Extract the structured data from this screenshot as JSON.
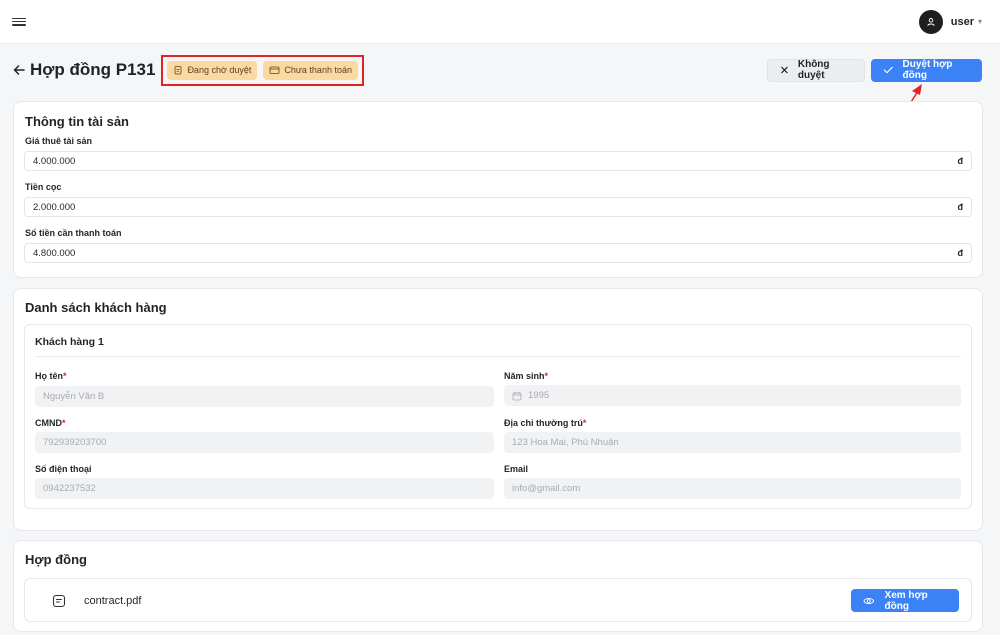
{
  "topbar": {
    "username": "user"
  },
  "header": {
    "title": "Hợp đồng P131",
    "badges": [
      "Đang chờ duyệt",
      "Chưa thanh toán"
    ],
    "reject_label": "Không duyệt",
    "approve_label": "Duyệt hợp đồng"
  },
  "property": {
    "title": "Thông tin tài sản",
    "fields": [
      {
        "label": "Giá thuê tài sản",
        "value": "4.000.000",
        "unit": "đ"
      },
      {
        "label": "Tiền cọc",
        "value": "2.000.000",
        "unit": "đ"
      },
      {
        "label": "Số tiền cần thanh toán",
        "value": "4.800.000",
        "unit": "đ"
      }
    ]
  },
  "customers": {
    "title": "Danh sách khách hàng",
    "customer": {
      "title": "Khách hàng 1",
      "name_label": "Họ tên",
      "name_value": "Nguyễn Văn B",
      "birth_label": "Năm sinh",
      "birth_value": "1995",
      "id_label": "CMND",
      "id_value": "792939203700",
      "address_label": "Địa chỉ thường trú",
      "address_value": "123 Hoa Mai, Phú Nhuận",
      "phone_label": "Số điện thoại",
      "phone_value": "0942237532",
      "email_label": "Email",
      "email_value": "info@gmail.com"
    }
  },
  "contract": {
    "title": "Hợp đồng",
    "file_name": "contract.pdf",
    "view_label": "Xem hợp đồng"
  },
  "colors": {
    "primary": "#3b82f6",
    "badge_bg": "#fbd9a1",
    "highlight": "#e02424"
  }
}
